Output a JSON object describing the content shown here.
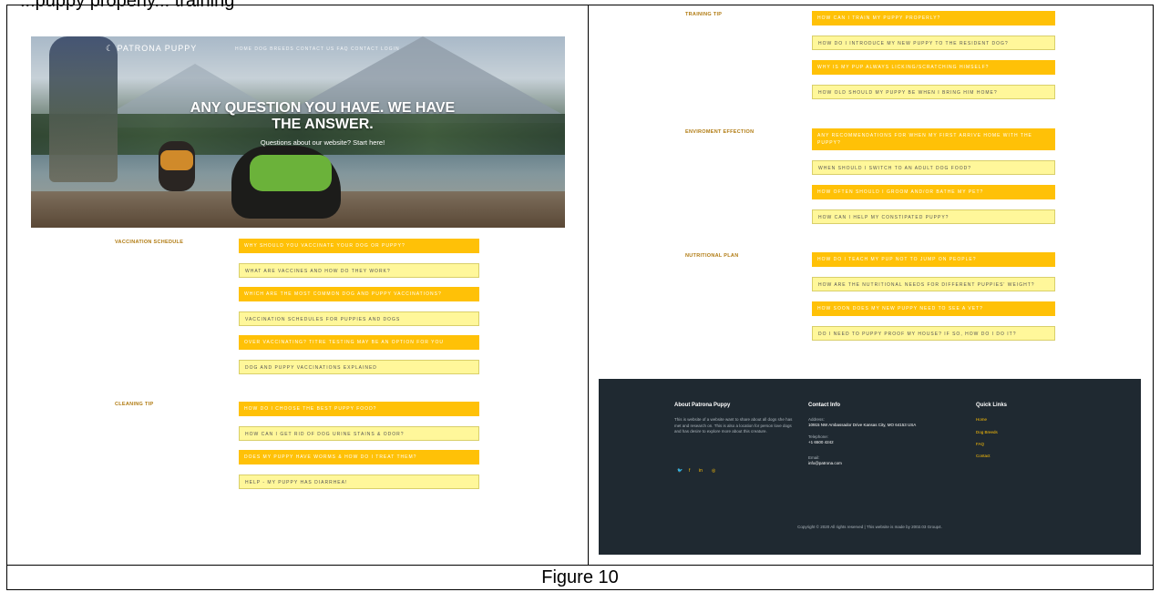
{
  "top_text": "...puppy properly... training",
  "caption": "Figure 10",
  "hero": {
    "brand": "PATRONA PUPPY",
    "nav": "HOME   DOG BREEDS   CONTACT US   FAQ   CONTACT   LOGIN",
    "title": "ANY QUESTION YOU HAVE. WE HAVE THE ANSWER.",
    "subtitle": "Questions about our website? Start here!"
  },
  "sections": {
    "vaccination": {
      "label": "VACCINATION SCHEDULE",
      "items": [
        "WHY SHOULD YOU VACCINATE YOUR DOG OR PUPPY?",
        "WHAT ARE VACCINES AND HOW DO THEY WORK?",
        "WHICH ARE THE MOST COMMON DOG AND PUPPY VACCINATIONS?",
        "VACCINATION SCHEDULES FOR PUPPIES AND DOGS",
        "OVER VACCINATING? TITRE TESTING MAY BE AN OPTION FOR YOU",
        "DOG AND PUPPY VACCINATIONS EXPLAINED"
      ]
    },
    "cleaning": {
      "label": "CLEANING TIP",
      "items": [
        "HOW DO I CHOOSE THE BEST PUPPY FOOD?",
        "HOW CAN I GET RID OF DOG URINE STAINS & ODOR?",
        "DOES MY PUPPY HAVE WORMS & HOW DO I TREAT THEM?",
        "HELP - MY PUPPY HAS DIARRHEA!"
      ]
    },
    "training": {
      "label": "TRAINING TIP",
      "items": [
        "HOW CAN I TRAIN MY PUPPY PROPERLY?",
        "HOW DO I INTRODUCE MY NEW PUPPY TO THE RESIDENT DOG?",
        "WHY IS MY PUP ALWAYS LICKING/SCRATCHING HIMSELF?",
        "HOW OLD SHOULD MY PUPPY BE WHEN I BRING HIM HOME?"
      ]
    },
    "environment": {
      "label": "ENVIROMENT EFFECTION",
      "items": [
        "ANY RECOMMENDATIONS FOR WHEN MY FIRST ARRIVE HOME WITH THE PUPPY?",
        "WHEN SHOULD I SWITCH TO AN ADULT DOG FOOD?",
        "HOW OFTEN SHOULD I GROOM AND/OR BATHE MY PET?",
        "HOW CAN I HELP MY CONSTIPATED PUPPY?"
      ]
    },
    "nutrition": {
      "label": "NUTRITIONAL PLAN",
      "items": [
        "HOW DO I TEACH MY PUP NOT TO JUMP ON PEOPLE?",
        "HOW ARE THE NUTRITIONAL NEEDS FOR DIFFERENT PUPPIES' WEIGHT?",
        "HOW SOON DOES MY NEW PUPPY NEED TO SEE A VET?",
        "DO I NEED TO PUPPY PROOF MY HOUSE? IF SO, HOW DO I DO IT?"
      ]
    }
  },
  "footer": {
    "about_title": "About Patrona Puppy",
    "about_text": "This is website of a website want to share about all dogs she has met and research on. This is also a location for person love dogs and has desire to explore more about this creature.",
    "contact_title": "Contact Info",
    "address_label": "Address:",
    "address": "10915 NW Ambassador Drive Kansas City, MO 64153 USA",
    "telephone_label": "Telephone:",
    "telephone": "+1 6500 4242",
    "email_label": "Email:",
    "email": "info@patrona.com",
    "links_title": "Quick Links",
    "links": [
      "Home",
      "Dog Breeds",
      "FAQ",
      "Contact"
    ],
    "social": [
      "twitter-icon",
      "facebook-icon",
      "linkedin-icon",
      "instagram-icon"
    ],
    "copyright": "Copyright © 2020 All rights reserved | This website is made by 2002.03 Group4."
  }
}
